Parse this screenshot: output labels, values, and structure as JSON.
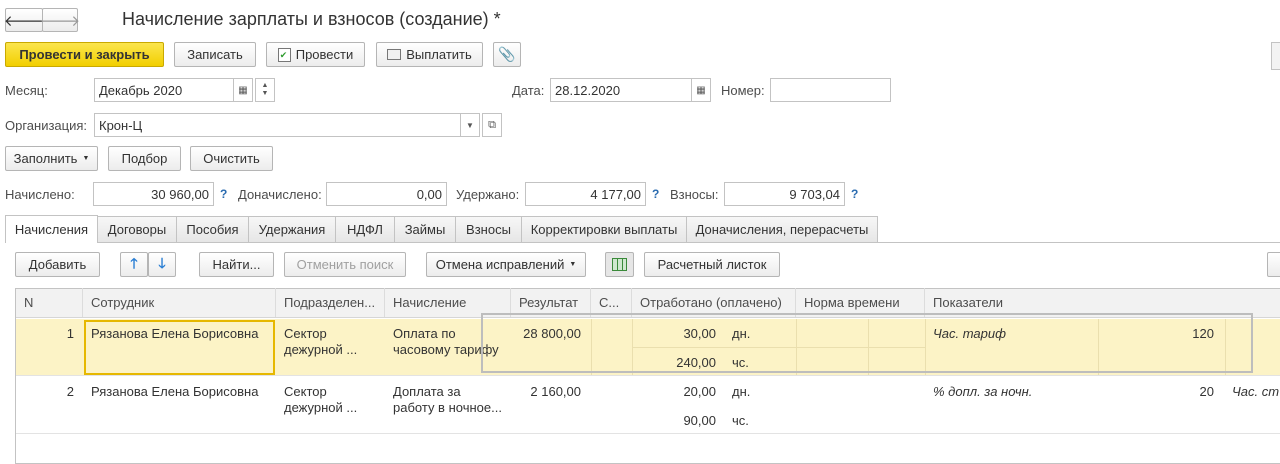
{
  "window": {
    "title": "Начисление зарплаты и взносов (создание) *"
  },
  "toolbar": {
    "post_close": "Провести и закрыть",
    "save": "Записать",
    "post": "Провести",
    "pay": "Выплатить"
  },
  "form": {
    "month_label": "Месяц:",
    "month_value": "Декабрь 2020",
    "date_label": "Дата:",
    "date_value": "28.12.2020",
    "number_label": "Номер:",
    "number_value": "",
    "org_label": "Организация:",
    "org_value": "Крон-Ц"
  },
  "actions": {
    "fill": "Заполнить",
    "select": "Подбор",
    "clear": "Очистить"
  },
  "totals": {
    "accrued_label": "Начислено:",
    "accrued_value": "30 960,00",
    "extra_label": "Доначислено:",
    "extra_value": "0,00",
    "withheld_label": "Удержано:",
    "withheld_value": "4 177,00",
    "contrib_label": "Взносы:",
    "contrib_value": "9 703,04",
    "help_mark": "?"
  },
  "tabs": [
    {
      "label": "Начисления",
      "active": true
    },
    {
      "label": "Договоры"
    },
    {
      "label": "Пособия"
    },
    {
      "label": "Удержания"
    },
    {
      "label": "НДФЛ"
    },
    {
      "label": "Займы"
    },
    {
      "label": "Взносы"
    },
    {
      "label": "Корректировки выплаты"
    },
    {
      "label": "Доначисления, перерасчеты"
    }
  ],
  "table_toolbar": {
    "add": "Добавить",
    "find": "Найти...",
    "cancel_search": "Отменить поиск",
    "cancel_corrections": "Отмена исправлений",
    "payslip": "Расчетный листок"
  },
  "table": {
    "columns": [
      "N",
      "Сотрудник",
      "Подразделен...",
      "Начисление",
      "Результат",
      "С...",
      "Отработано (оплачено)",
      "Норма времени",
      "Показатели"
    ],
    "rows": [
      {
        "n": "1",
        "employee": "Рязанова Елена Борисовна",
        "dept": "Сектор дежурной ...",
        "accrual": "Оплата по часовому тарифу",
        "result": "28 800,00",
        "worked_days": "30,00",
        "days_unit": "дн.",
        "worked_hours": "240,00",
        "hours_unit": "чс.",
        "indicator_name": "Час. тариф",
        "indicator_value": "120",
        "indicator_extra": ""
      },
      {
        "n": "2",
        "employee": "Рязанова Елена Борисовна",
        "dept": "Сектор дежурной ...",
        "accrual": "Доплата за работу в ночное...",
        "result": "2 160,00",
        "worked_days": "20,00",
        "days_unit": "дн.",
        "worked_hours": "90,00",
        "hours_unit": "чс.",
        "indicator_name": "% допл. за ночн.",
        "indicator_value": "20",
        "indicator_extra": "Час. ст"
      }
    ]
  },
  "colors": {
    "accent_yellow": "#f2cf00",
    "selected_row": "#fcf3c6",
    "selected_cell_border": "#e6b800",
    "link_blue": "#2b6cb0"
  }
}
